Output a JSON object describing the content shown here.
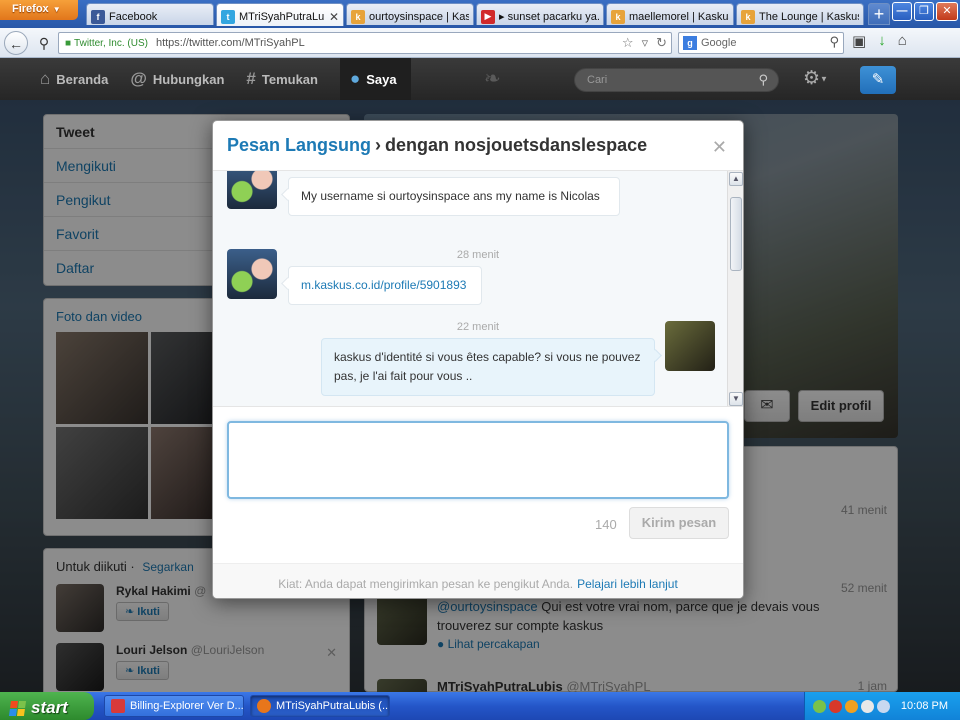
{
  "browser": {
    "menu_label": "Firefox",
    "tabs": [
      {
        "label": "Facebook",
        "icon": "facebook-icon",
        "color": "#3b5998",
        "glyph": "f"
      },
      {
        "label": "MTriSyahPutraLu...",
        "icon": "twitter-icon",
        "color": "#33a6e0",
        "glyph": "t",
        "active": true
      },
      {
        "label": "ourtoysinspace | Kas...",
        "icon": "kaskus-icon",
        "color": "#e7a33a",
        "glyph": "k"
      },
      {
        "label": "▸ sunset pacarku ya...",
        "icon": "youtube-icon",
        "color": "#d12a2a",
        "glyph": "▶"
      },
      {
        "label": "maellemorel | Kaskus...",
        "icon": "kaskus-icon",
        "color": "#e7a33a",
        "glyph": "k"
      },
      {
        "label": "The Lounge | Kaskus...",
        "icon": "kaskus-icon",
        "color": "#e7a33a",
        "glyph": "k"
      }
    ],
    "ssl_label": "Twitter, Inc. (US)",
    "url": "https://twitter.com/MTriSyahPL",
    "search_engine": "Google"
  },
  "twitter_nav": {
    "items": [
      {
        "label": "Beranda",
        "icon": "home-icon",
        "glyph": "⌂"
      },
      {
        "label": "Hubungkan",
        "icon": "at-icon",
        "glyph": "@"
      },
      {
        "label": "Temukan",
        "icon": "hash-icon",
        "glyph": "#"
      },
      {
        "label": "Saya",
        "icon": "user-icon",
        "glyph": "▲",
        "active": true
      }
    ],
    "search_placeholder": "Cari"
  },
  "sidebar": {
    "menu": [
      "Tweet",
      "Mengikuti",
      "Pengikut",
      "Favorit",
      "Daftar"
    ],
    "media_title": "Foto dan video",
    "follow_title": "Untuk diikuti",
    "refresh_label": "Segarkan",
    "suggestions": [
      {
        "name": "Rykal Hakimi",
        "handle": "@",
        "follow_label": "Ikuti"
      },
      {
        "name": "Louri Jelson",
        "handle": "@LouriJelson",
        "follow_label": "Ikuti"
      }
    ]
  },
  "profile": {
    "edit_label": "Edit profil"
  },
  "stream": {
    "items": [
      {
        "time": "41 menit"
      },
      {
        "time": "52 menit",
        "mention": "@ourtoysinspace",
        "text": " Qui est votre vrai nom, parce que je devais vous trouverez sur compte kaskus",
        "convo": "Lihat percakapan"
      },
      {
        "time": "1 jam",
        "name": "MTriSyahPutraLubis",
        "handle": "@MTriSyahPL"
      }
    ]
  },
  "dm_modal": {
    "title": "Pesan Langsung",
    "separator": "›",
    "with_label": "dengan nosjouetsdanslespace",
    "messages": [
      {
        "text": "My username si ourtoysinspace ans my name is Nicolas"
      },
      {
        "time": "28 menit",
        "text": "m.kaskus.co.id/profile/5901893"
      },
      {
        "time": "22 menit",
        "text": "kaskus d'identité si vous êtes capable? si vous ne pouvez pas, je l'ai fait pour vous .."
      }
    ],
    "compose_value": "",
    "char_count": "140",
    "send_label": "Kirim pesan",
    "footer_text": "Kiat: Anda dapat mengirimkan pesan ke pengikut Anda.",
    "footer_link": "Pelajari lebih lanjut"
  },
  "taskbar": {
    "start_label": "start",
    "tasks": [
      {
        "label": "Billing-Explorer Ver D...",
        "icon": "billing-icon",
        "color": "#d83a3a"
      },
      {
        "label": "MTriSyahPutraLubis (...",
        "icon": "firefox-icon",
        "color": "#e8761b",
        "active": true
      }
    ],
    "clock": "10:08 PM"
  }
}
